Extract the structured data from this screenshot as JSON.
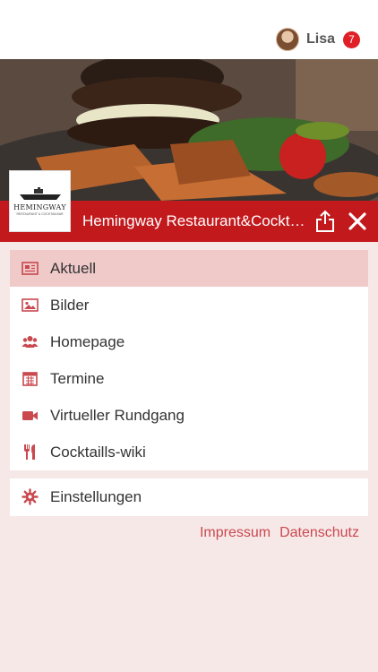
{
  "header": {
    "user_name": "Lisa",
    "notification_count": "7"
  },
  "venue": {
    "title": "Hemingway Restaurant&Cocktailbar",
    "logo_text": "HEMINGWAY",
    "logo_subtext": "RESTAURANT & COCKTAILBAR"
  },
  "menu": {
    "items": [
      {
        "label": "Aktuell",
        "icon": "newspaper-icon",
        "active": true
      },
      {
        "label": "Bilder",
        "icon": "image-icon",
        "active": false
      },
      {
        "label": "Homepage",
        "icon": "users-icon",
        "active": false
      },
      {
        "label": "Termine",
        "icon": "calendar-icon",
        "active": false
      },
      {
        "label": "Virtueller Rundgang",
        "icon": "video-camera-icon",
        "active": false
      },
      {
        "label": "Cocktaills-wiki",
        "icon": "fork-knife-icon",
        "active": false
      }
    ],
    "settings_label": "Einstellungen"
  },
  "footer": {
    "impressum": "Impressum",
    "datenschutz": "Datenschutz"
  },
  "colors": {
    "accent": "#c2191d",
    "active_row": "#f0c9c9",
    "background": "#f7e8e8",
    "icon": "#c9494f",
    "badge": "#e01e27"
  }
}
